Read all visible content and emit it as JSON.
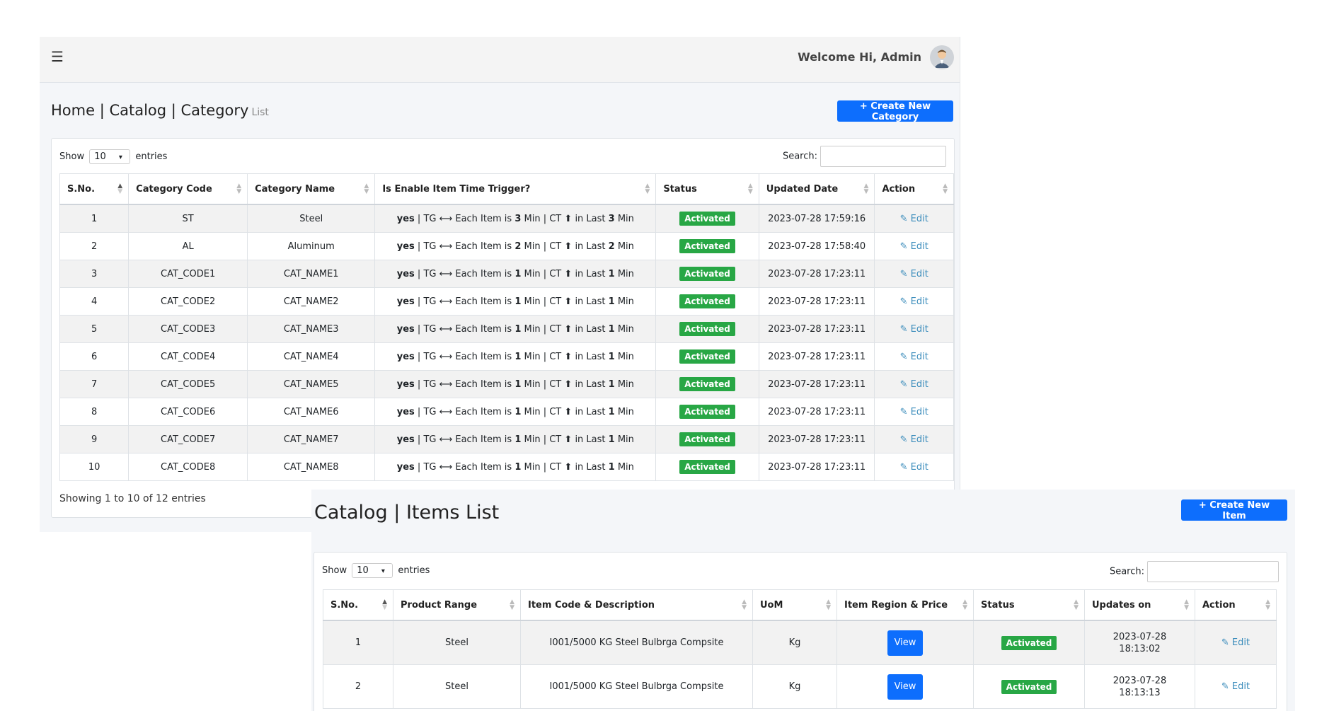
{
  "header": {
    "welcome_text": "Welcome Hi, Admin",
    "menu_icon": "hamburger-icon",
    "avatar_icon": "user-avatar-icon"
  },
  "category_page": {
    "breadcrumb": "Home | Catalog | Category",
    "breadcrumb_suffix": "List",
    "create_button": "+ Create New Category",
    "length_label_before": "Show",
    "length_value": "10",
    "length_label_after": "entries",
    "search_label": "Search:",
    "columns": [
      "S.No.",
      "Category Code",
      "Category Name",
      "Is Enable Item Time Trigger?",
      "Status",
      "Updated Date",
      "Action"
    ],
    "rows": [
      {
        "sno": "1",
        "code": "ST",
        "name": "Steel",
        "trigger": {
          "enabled": "yes",
          "tg": "3",
          "ct": "3"
        },
        "status": "Activated",
        "updated": "2023-07-28 17:59:16",
        "action": "Edit"
      },
      {
        "sno": "2",
        "code": "AL",
        "name": "Aluminum",
        "trigger": {
          "enabled": "yes",
          "tg": "2",
          "ct": "2"
        },
        "status": "Activated",
        "updated": "2023-07-28 17:58:40",
        "action": "Edit"
      },
      {
        "sno": "3",
        "code": "CAT_CODE1",
        "name": "CAT_NAME1",
        "trigger": {
          "enabled": "yes",
          "tg": "1",
          "ct": "1"
        },
        "status": "Activated",
        "updated": "2023-07-28 17:23:11",
        "action": "Edit"
      },
      {
        "sno": "4",
        "code": "CAT_CODE2",
        "name": "CAT_NAME2",
        "trigger": {
          "enabled": "yes",
          "tg": "1",
          "ct": "1"
        },
        "status": "Activated",
        "updated": "2023-07-28 17:23:11",
        "action": "Edit"
      },
      {
        "sno": "5",
        "code": "CAT_CODE3",
        "name": "CAT_NAME3",
        "trigger": {
          "enabled": "yes",
          "tg": "1",
          "ct": "1"
        },
        "status": "Activated",
        "updated": "2023-07-28 17:23:11",
        "action": "Edit"
      },
      {
        "sno": "6",
        "code": "CAT_CODE4",
        "name": "CAT_NAME4",
        "trigger": {
          "enabled": "yes",
          "tg": "1",
          "ct": "1"
        },
        "status": "Activated",
        "updated": "2023-07-28 17:23:11",
        "action": "Edit"
      },
      {
        "sno": "7",
        "code": "CAT_CODE5",
        "name": "CAT_NAME5",
        "trigger": {
          "enabled": "yes",
          "tg": "1",
          "ct": "1"
        },
        "status": "Activated",
        "updated": "2023-07-28 17:23:11",
        "action": "Edit"
      },
      {
        "sno": "8",
        "code": "CAT_CODE6",
        "name": "CAT_NAME6",
        "trigger": {
          "enabled": "yes",
          "tg": "1",
          "ct": "1"
        },
        "status": "Activated",
        "updated": "2023-07-28 17:23:11",
        "action": "Edit"
      },
      {
        "sno": "9",
        "code": "CAT_CODE7",
        "name": "CAT_NAME7",
        "trigger": {
          "enabled": "yes",
          "tg": "1",
          "ct": "1"
        },
        "status": "Activated",
        "updated": "2023-07-28 17:23:11",
        "action": "Edit"
      },
      {
        "sno": "10",
        "code": "CAT_CODE8",
        "name": "CAT_NAME8",
        "trigger": {
          "enabled": "yes",
          "tg": "1",
          "ct": "1"
        },
        "status": "Activated",
        "updated": "2023-07-28 17:23:11",
        "action": "Edit"
      }
    ],
    "trigger_text": {
      "tg": "TG",
      "each_item": "Each Item is",
      "min": "Min",
      "ct": "CT",
      "in_last": "in Last"
    },
    "info": "Showing 1 to 10 of 12 entries"
  },
  "items_page": {
    "title": "Catalog | Items List",
    "create_button": "+ Create New Item",
    "length_label_before": "Show",
    "length_value": "10",
    "length_label_after": "entries",
    "search_label": "Search:",
    "columns": [
      "S.No.",
      "Product Range",
      "Item Code & Description",
      "UoM",
      "Item Region & Price",
      "Status",
      "Updates on",
      "Action"
    ],
    "rows": [
      {
        "sno": "1",
        "range": "Steel",
        "item": "I001/5000 KG Steel Bulbrga Compsite",
        "uom": "Kg",
        "view": "View",
        "status": "Activated",
        "date": "2023-07-28",
        "time": "18:13:02",
        "action": "Edit"
      },
      {
        "sno": "2",
        "range": "Steel",
        "item": "I001/5000 KG Steel Bulbrga Compsite",
        "uom": "Kg",
        "view": "View",
        "status": "Activated",
        "date": "2023-07-28",
        "time": "18:13:13",
        "action": "Edit"
      }
    ]
  },
  "colors": {
    "primary": "#0d6efd",
    "success": "#28a745",
    "link": "#3c8dbc"
  }
}
